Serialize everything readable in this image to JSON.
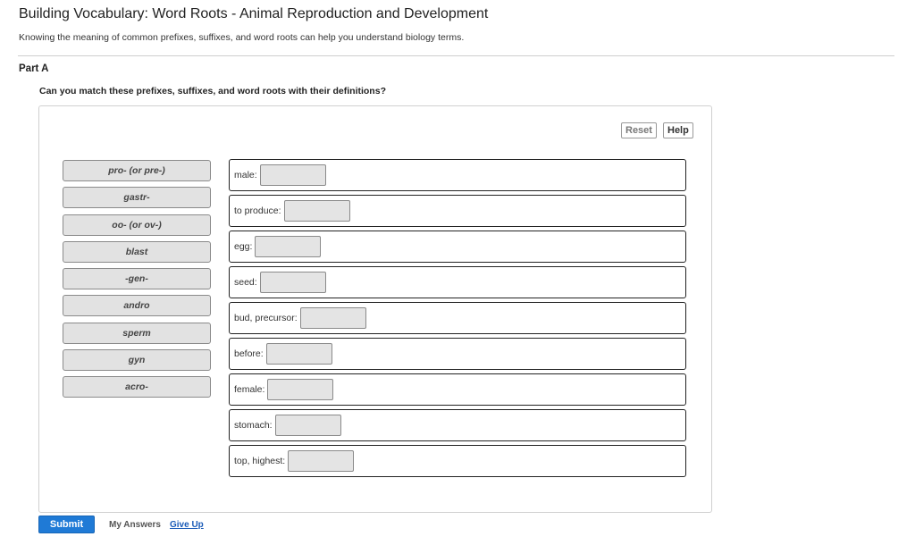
{
  "header": {
    "title": "Building Vocabulary: Word Roots - Animal Reproduction and Development",
    "subtitle": "Knowing the meaning of common prefixes, suffixes, and word roots can help you understand biology terms."
  },
  "part": {
    "label": "Part A",
    "question": "Can you match these prefixes, suffixes, and word roots with their definitions?"
  },
  "toolbar": {
    "reset_label": "Reset",
    "help_label": "Help"
  },
  "tiles": [
    "pro- (or pre-)",
    "gastr-",
    "oo- (or ov-)",
    "blast",
    "-gen-",
    "andro",
    "sperm",
    "gyn",
    "acro-"
  ],
  "targets": [
    "male:",
    "to produce:",
    "egg:",
    "seed:",
    "bud, precursor:",
    "before:",
    "female:",
    "stomach:",
    "top, highest:"
  ],
  "footer": {
    "submit_label": "Submit",
    "my_answers_label": "My Answers",
    "give_up_label": "Give Up"
  }
}
